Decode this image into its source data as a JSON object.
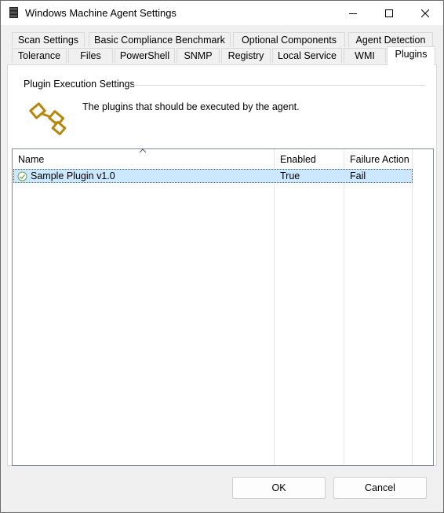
{
  "window": {
    "title": "Windows Machine Agent Settings"
  },
  "tabs_row1": [
    "Scan Settings",
    "Basic Compliance Benchmark",
    "Optional Components",
    "Agent Detection"
  ],
  "tabs_row2": [
    "Tolerance",
    "Files",
    "PowerShell",
    "SNMP",
    "Registry",
    "Local Service",
    "WMI",
    "Plugins"
  ],
  "active_tab": "Plugins",
  "plugins_panel": {
    "group_label": "Plugin Execution Settings",
    "description": "The plugins that should be executed by the agent.",
    "icon": "plugin-icon",
    "columns": [
      "Name",
      "Enabled",
      "Failure Action"
    ],
    "sort_column": "Name",
    "rows": [
      {
        "name": "Sample Plugin v1.0",
        "enabled": "True",
        "failure_action": "Fail",
        "icon": "check-circle-icon",
        "selected": true
      }
    ]
  },
  "buttons": {
    "ok": "OK",
    "cancel": "Cancel"
  },
  "colors": {
    "accent_gold": "#b8860b",
    "selection": "#cce8ff",
    "check_green": "#6aa84f"
  }
}
